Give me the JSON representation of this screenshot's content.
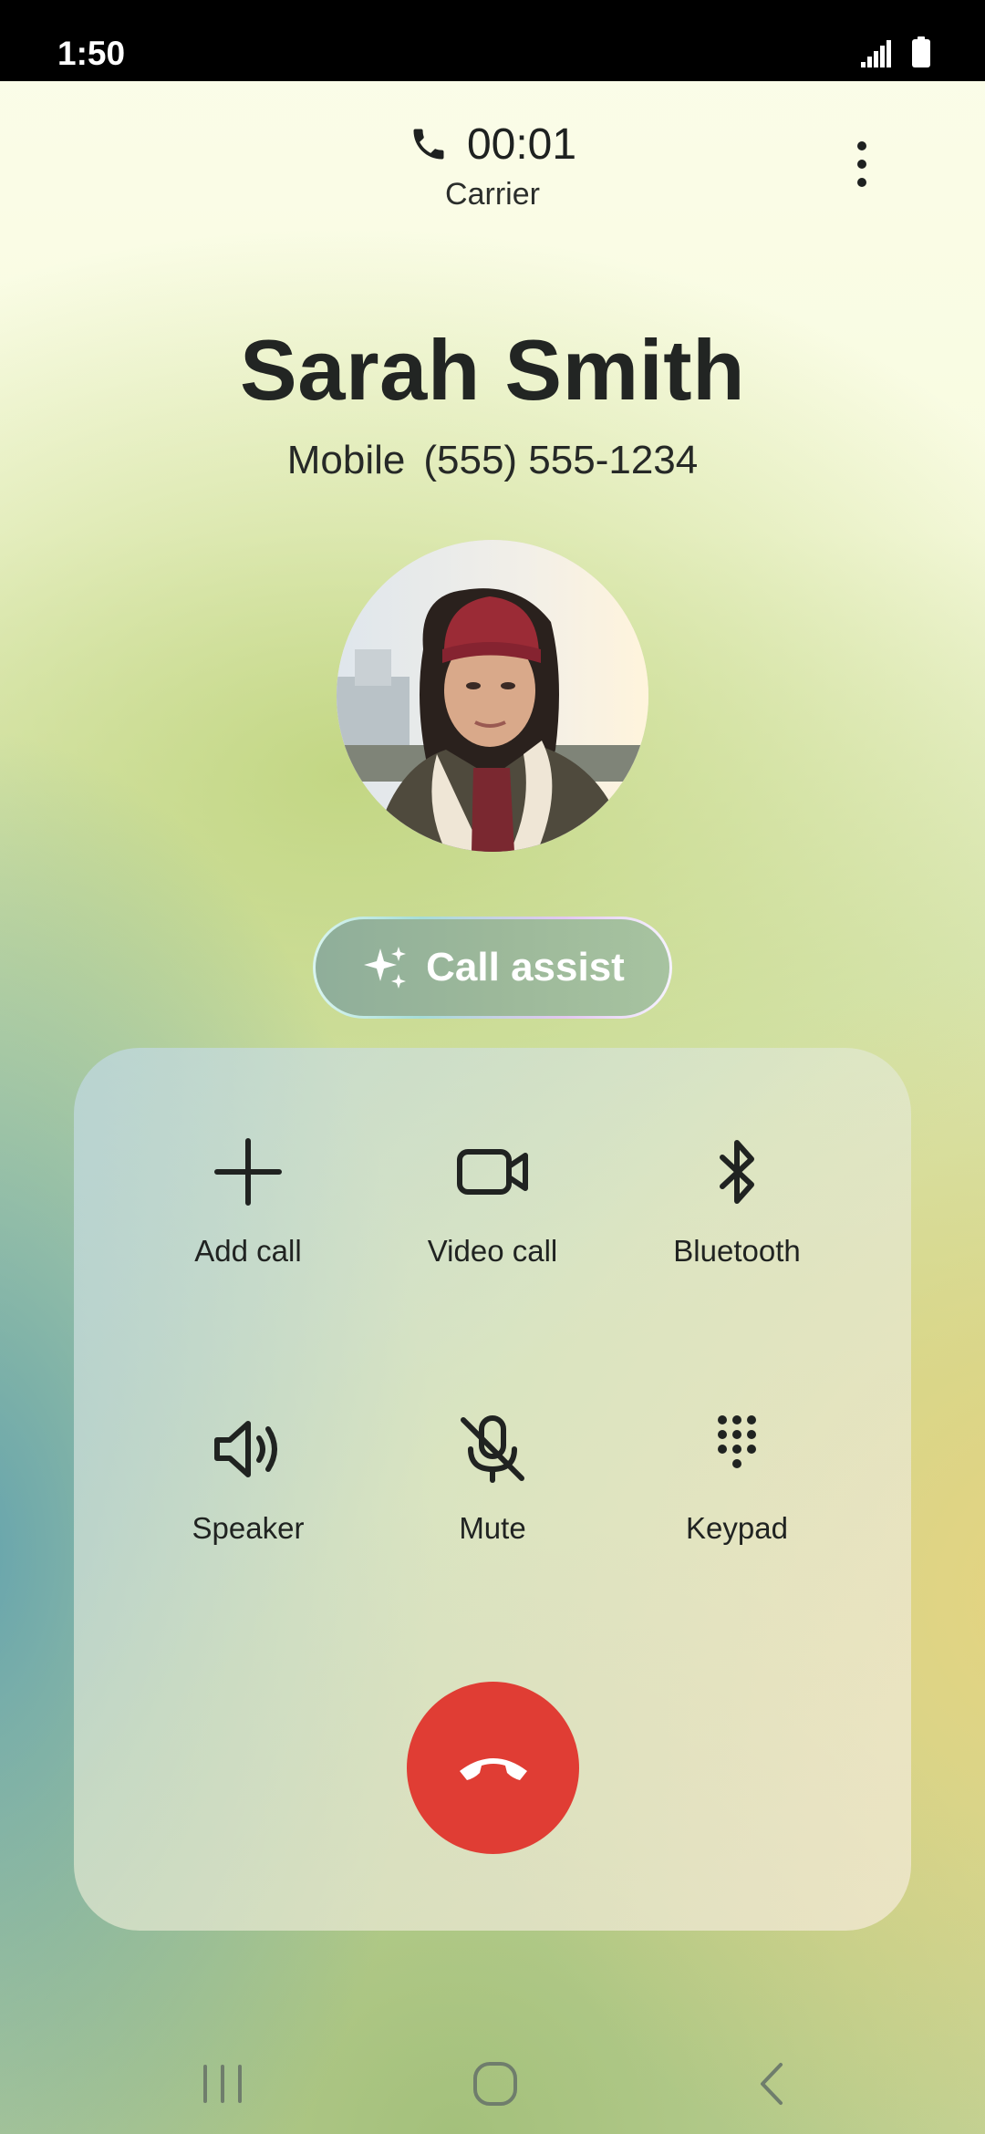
{
  "status_bar": {
    "time": "1:50"
  },
  "call_header": {
    "timer": "00:01",
    "carrier": "Carrier"
  },
  "contact": {
    "name": "Sarah Smith",
    "number_label": "Mobile",
    "number": "(555) 555-1234"
  },
  "call_assist": {
    "label": "Call assist"
  },
  "actions": [
    {
      "label": "Add call",
      "icon": "plus-icon"
    },
    {
      "label": "Video call",
      "icon": "video-camera-icon"
    },
    {
      "label": "Bluetooth",
      "icon": "bluetooth-icon"
    },
    {
      "label": "Speaker",
      "icon": "speaker-icon"
    },
    {
      "label": "Mute",
      "icon": "mic-off-icon"
    },
    {
      "label": "Keypad",
      "icon": "keypad-icon"
    }
  ],
  "colors": {
    "end_call": "#e03d34",
    "status_bar": "#000000"
  }
}
